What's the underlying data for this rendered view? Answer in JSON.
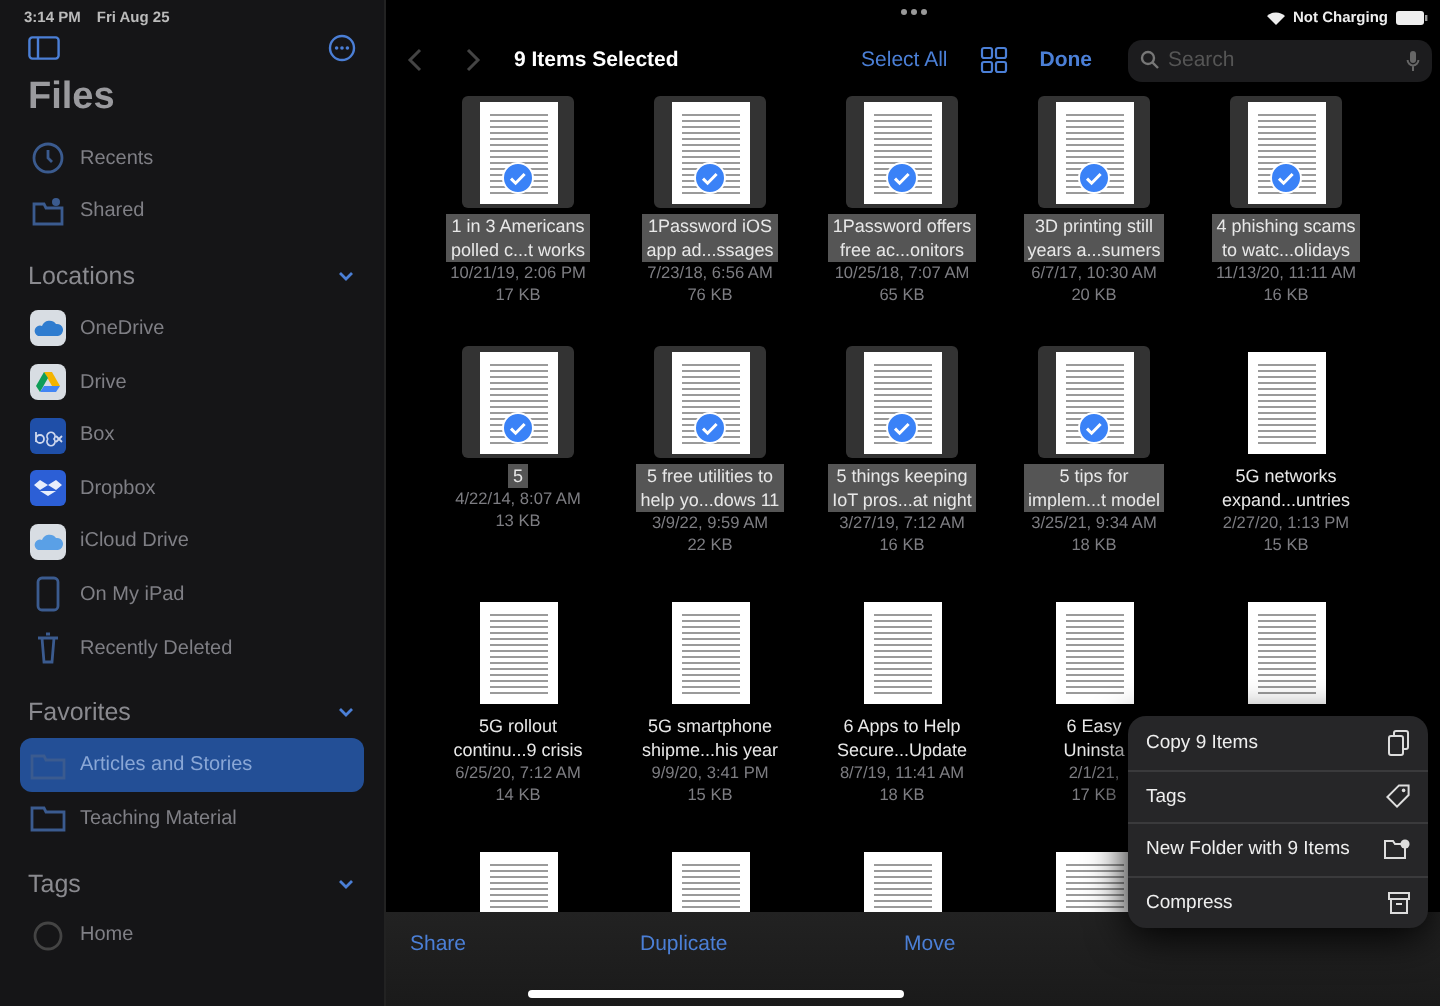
{
  "status_bar": {
    "time": "3:14 PM",
    "date": "Fri Aug 25",
    "battery_text": "Not Charging"
  },
  "sidebar": {
    "title": "Files",
    "top_items": [
      {
        "label": "Recents",
        "selected": false
      },
      {
        "label": "Shared",
        "selected": false
      }
    ],
    "sections": [
      {
        "title": "Locations",
        "expanded": true,
        "items": [
          {
            "label": "OneDrive",
            "selected": false
          },
          {
            "label": "Drive",
            "selected": false
          },
          {
            "label": "Box",
            "selected": false
          },
          {
            "label": "Dropbox",
            "selected": false
          },
          {
            "label": "iCloud Drive",
            "selected": false
          },
          {
            "label": "On My iPad",
            "selected": false
          },
          {
            "label": "Recently Deleted",
            "selected": false
          }
        ]
      },
      {
        "title": "Favorites",
        "expanded": true,
        "items": [
          {
            "label": "Articles and Stories",
            "selected": true
          },
          {
            "label": "Teaching Material",
            "selected": false
          }
        ]
      },
      {
        "title": "Tags",
        "expanded": true,
        "items": [
          {
            "label": "Home",
            "selected": false
          }
        ]
      }
    ]
  },
  "navigation": {
    "title": "9 Items Selected",
    "select_all": "Select All",
    "done": "Done",
    "search": {
      "placeholder": "Search"
    }
  },
  "files": [
    {
      "name": "1 in 3 Americans\npolled c...t works",
      "date": "10/21/19, 2:06 PM",
      "size": "17 KB",
      "selected": true
    },
    {
      "name": "1Password iOS\napp ad...ssages",
      "date": "7/23/18, 6:56 AM",
      "size": "76 KB",
      "selected": true
    },
    {
      "name": "1Password offers\nfree ac...onitors",
      "date": "10/25/18, 7:07 AM",
      "size": "65 KB",
      "selected": true
    },
    {
      "name": "3D printing still\nyears a...sumers",
      "date": "6/7/17, 10:30 AM",
      "size": "20 KB",
      "selected": true
    },
    {
      "name": "4 phishing scams\nto watc...olidays",
      "date": "11/13/20, 11:11 AM",
      "size": "16 KB",
      "selected": true
    },
    {
      "name": "5",
      "date": "4/22/14, 8:07 AM",
      "size": "13 KB",
      "selected": true
    },
    {
      "name": "5 free utilities to\nhelp yo...dows 11",
      "date": "3/9/22, 9:59 AM",
      "size": "22 KB",
      "selected": true
    },
    {
      "name": "5 things keeping\nIoT pros...at night",
      "date": "3/27/19, 7:12 AM",
      "size": "16 KB",
      "selected": true
    },
    {
      "name": "5 tips for\nimplem...t model",
      "date": "3/25/21, 9:34 AM",
      "size": "18 KB",
      "selected": true
    },
    {
      "name": "5G networks\nexpand...untries",
      "date": "2/27/20, 1:13 PM",
      "size": "15 KB",
      "selected": false
    },
    {
      "name": "5G rollout\ncontinu...9 crisis",
      "date": "6/25/20, 7:12 AM",
      "size": "14 KB",
      "selected": false
    },
    {
      "name": "5G smartphone\nshipme...his year",
      "date": "9/9/20, 3:41 PM",
      "size": "15 KB",
      "selected": false
    },
    {
      "name": "6 Apps to Help\nSecure...Update",
      "date": "8/7/19, 11:41 AM",
      "size": "18 KB",
      "selected": false
    },
    {
      "name": "6 Easy\nUninsta",
      "date": "2/1/21,",
      "size": "17 KB",
      "selected": false
    },
    {
      "selected": false
    },
    {
      "selected": false
    },
    {
      "selected": false
    },
    {
      "selected": false
    },
    {
      "selected": false
    }
  ],
  "context_menu": [
    {
      "label": "Copy 9 Items"
    },
    {
      "label": "Tags"
    },
    {
      "label": "New Folder with 9 Items"
    },
    {
      "label": "Compress"
    }
  ],
  "toolbar": [
    "Share",
    "Duplicate",
    "Move"
  ]
}
